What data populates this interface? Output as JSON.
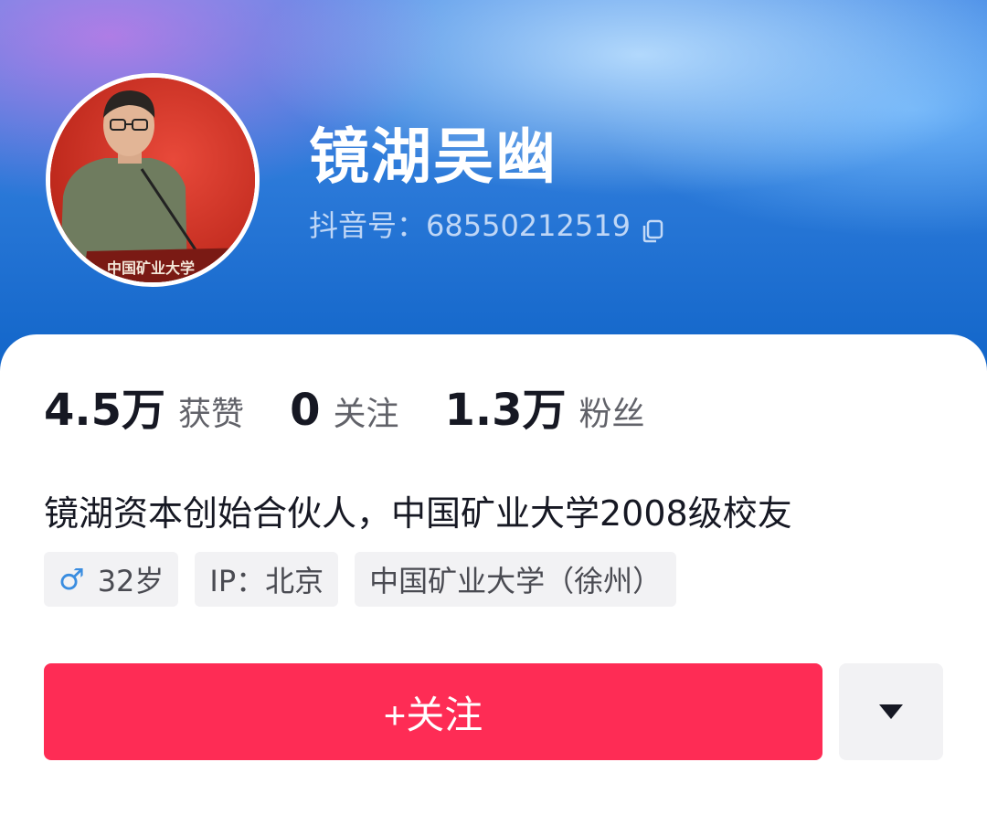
{
  "profile": {
    "name": "镜湖吴幽",
    "douyin_id": "抖音号：68550212519",
    "avatar_podium_text": "中国矿业大学"
  },
  "stats": [
    {
      "value": "4.5万",
      "label": "获赞"
    },
    {
      "value": "0",
      "label": "关注"
    },
    {
      "value": "1.3万",
      "label": "粉丝"
    }
  ],
  "bio": "镜湖资本创始合伙人，中国矿业大学2008级校友",
  "tags": {
    "gender_icon": "♂",
    "age": "32岁",
    "ip": "IP：北京",
    "school": "中国矿业大学（徐州）"
  },
  "actions": {
    "follow_label": "+关注",
    "more_icon": "caret-down-icon"
  },
  "colors": {
    "accent": "#fe2c55",
    "header_blue": "#1064c8",
    "gender_blue": "#3a8de0"
  }
}
